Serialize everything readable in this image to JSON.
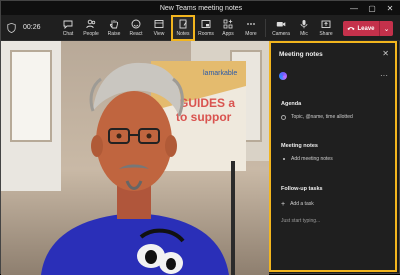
{
  "window": {
    "title": "New Teams meeting notes",
    "controls": [
      "minimize-icon",
      "maximize-icon",
      "close-icon"
    ]
  },
  "toolbar": {
    "timer": "00:26",
    "buttons": [
      {
        "label": "Chat",
        "icon": "chat-icon"
      },
      {
        "label": "People",
        "icon": "people-icon"
      },
      {
        "label": "Raise",
        "icon": "raise-hand-icon"
      },
      {
        "label": "React",
        "icon": "react-icon"
      },
      {
        "label": "View",
        "icon": "view-icon"
      },
      {
        "label": "Notes",
        "icon": "notes-icon"
      },
      {
        "label": "Rooms",
        "icon": "rooms-icon"
      },
      {
        "label": "Apps",
        "icon": "apps-icon"
      },
      {
        "label": "More",
        "icon": "more-icon"
      },
      {
        "label": "Camera",
        "icon": "camera-icon"
      },
      {
        "label": "Mic",
        "icon": "mic-icon"
      },
      {
        "label": "Share",
        "icon": "share-icon"
      }
    ],
    "leave_label": "Leave",
    "leave_color": "#c4314b",
    "highlight_color": "#f2b51e"
  },
  "video": {
    "poster_lines": [
      "GUIDES a",
      "to suppor"
    ],
    "poster_brand": "lamarkable"
  },
  "notes_panel": {
    "title": "Meeting notes",
    "agenda": {
      "heading": "Agenda",
      "placeholder": "Topic, @name, time allotted"
    },
    "meeting_notes": {
      "heading": "Meeting notes",
      "placeholder": "Add meeting notes"
    },
    "follow_up": {
      "heading": "Follow-up tasks",
      "add_label": "Add a task"
    },
    "typing_hint": "Just start typing..."
  }
}
